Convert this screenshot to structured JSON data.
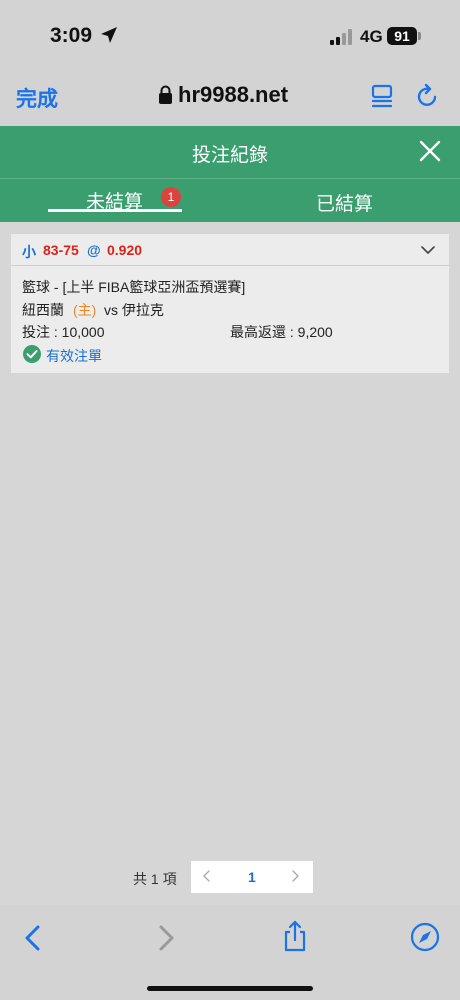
{
  "status_bar": {
    "time": "3:09",
    "network": "4G",
    "battery": "91"
  },
  "browser": {
    "done_label": "完成",
    "url": "hr9988.net"
  },
  "header": {
    "title": "投注紀錄"
  },
  "tabs": [
    {
      "label": "未結算",
      "badge": "1",
      "active": true
    },
    {
      "label": "已結算",
      "active": false
    }
  ],
  "bet": {
    "type": "小",
    "line": "83-75",
    "at": "@",
    "odds": "0.920",
    "league": "籃球 - [上半 FIBA籃球亞洲盃預選賽]",
    "home_team": "紐西蘭",
    "home_tag": "(主)",
    "vs_away": "vs 伊拉克",
    "stake": "投注 : 10,000",
    "max_return": "最高返還 : 9,200",
    "status": "有效注單"
  },
  "pagination": {
    "total": "共 1 項",
    "current": "1"
  },
  "colors": {
    "accent_green": "#3a9e6f",
    "link_blue": "#1a73e8",
    "odds_red": "#d9241c",
    "home_orange": "#e8862a"
  }
}
